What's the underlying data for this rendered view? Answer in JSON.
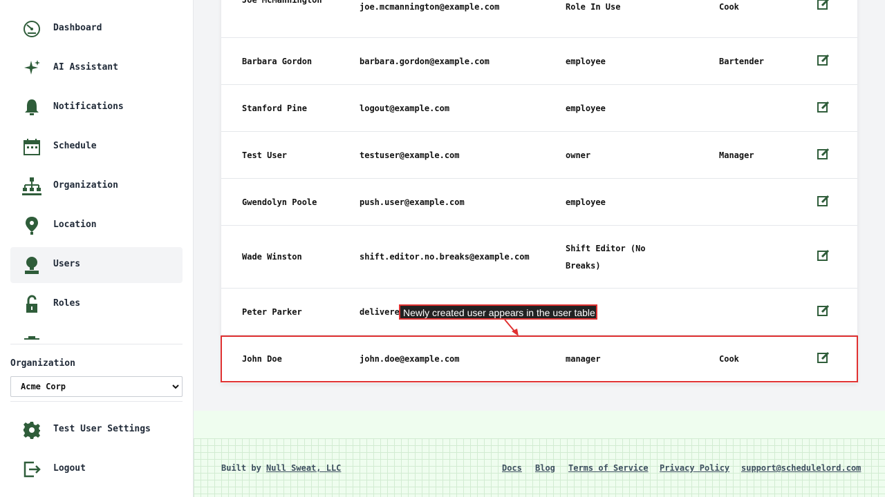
{
  "sidebar": {
    "items": [
      {
        "label": "Dashboard",
        "icon": "dashboard-icon"
      },
      {
        "label": "AI Assistant",
        "icon": "sparkle-icon"
      },
      {
        "label": "Notifications",
        "icon": "bell-icon"
      },
      {
        "label": "Schedule",
        "icon": "calendar-icon"
      },
      {
        "label": "Organization",
        "icon": "org-chart-icon"
      },
      {
        "label": "Location",
        "icon": "map-pin-icon"
      },
      {
        "label": "Users",
        "icon": "user-icon",
        "active": true
      },
      {
        "label": "Roles",
        "icon": "lock-icon"
      }
    ],
    "org_label": "Organization",
    "org_selected": "Acme Corp",
    "settings_label": "Test User Settings",
    "logout_label": "Logout"
  },
  "table": {
    "rows": [
      {
        "name": "Joe McMannington",
        "email": "joe.mcmannington@example.com",
        "role": "Role In Use",
        "position": "Cook"
      },
      {
        "name": "Barbara Gordon",
        "email": "barbara.gordon@example.com",
        "role": "employee",
        "position": "Bartender"
      },
      {
        "name": "Stanford Pine",
        "email": "logout@example.com",
        "role": "employee",
        "position": ""
      },
      {
        "name": "Test User",
        "email": "testuser@example.com",
        "role": "owner",
        "position": "Manager"
      },
      {
        "name": "Gwendolyn Poole",
        "email": "push.user@example.com",
        "role": "employee",
        "position": ""
      },
      {
        "name": "Wade Winston",
        "email": "shift.editor.no.breaks@example.com",
        "role": "Shift Editor (No Breaks)",
        "position": ""
      },
      {
        "name": "Peter Parker",
        "email": "delivere",
        "role": "",
        "position": ""
      },
      {
        "name": "John Doe",
        "email": "john.doe@example.com",
        "role": "manager",
        "position": "Cook"
      }
    ]
  },
  "annotation": {
    "text": "Newly created user appears in the user table",
    "color": "#e03131"
  },
  "footer": {
    "built_by_prefix": "Built by",
    "built_by_link": "Null Sweat, LLC",
    "links": [
      "Docs",
      "Blog",
      "Terms of Service",
      "Privacy Policy",
      "support@schedulelord.com"
    ]
  },
  "colors": {
    "accent": "#2f5d3a",
    "highlight": "#e03131",
    "footer_bg": "#effdef"
  }
}
